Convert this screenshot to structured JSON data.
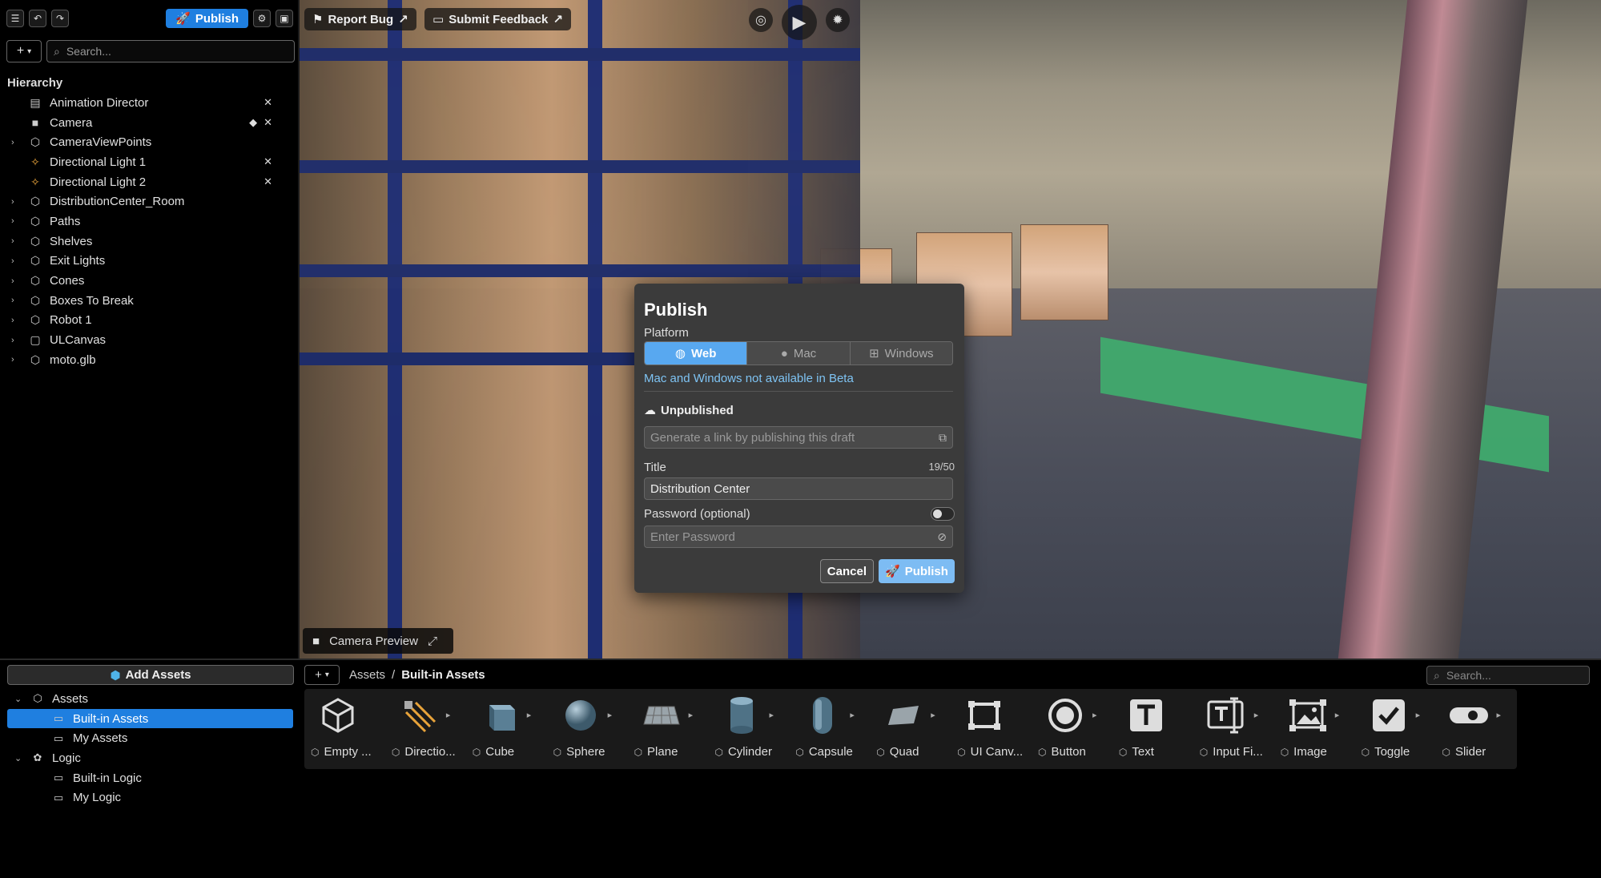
{
  "toolbar": {
    "publish_label": "Publish",
    "report_bug": "Report Bug",
    "submit_feedback": "Submit Feedback"
  },
  "hierarchy": {
    "search_placeholder": "Search...",
    "title": "Hierarchy",
    "items": [
      {
        "label": "Animation Director",
        "icon": "animation-icon",
        "expandable": false
      },
      {
        "label": "Camera",
        "icon": "camera-icon",
        "expandable": false
      },
      {
        "label": "CameraViewPoints",
        "icon": "cube-icon",
        "expandable": true
      },
      {
        "label": "Directional Light 1",
        "icon": "light-icon",
        "expandable": false
      },
      {
        "label": "Directional Light 2",
        "icon": "light-icon",
        "expandable": false
      },
      {
        "label": "DistributionCenter_Room",
        "icon": "cube-icon",
        "expandable": true
      },
      {
        "label": "Paths",
        "icon": "cube-icon",
        "expandable": true
      },
      {
        "label": "Shelves",
        "icon": "cube-icon",
        "expandable": true
      },
      {
        "label": "Exit Lights",
        "icon": "cube-icon",
        "expandable": true
      },
      {
        "label": "Cones",
        "icon": "cube-icon",
        "expandable": true
      },
      {
        "label": "Boxes To Break",
        "icon": "cube-icon",
        "expandable": true
      },
      {
        "label": "Robot 1",
        "icon": "cube-icon",
        "expandable": true
      },
      {
        "label": "ULCanvas",
        "icon": "canvas-icon",
        "expandable": true
      },
      {
        "label": "moto.glb",
        "icon": "cube-icon",
        "expandable": true
      }
    ]
  },
  "modal": {
    "title": "Publish",
    "platform_label": "Platform",
    "platforms": [
      "Web",
      "Mac",
      "Windows"
    ],
    "active_platform": "Web",
    "beta_note": "Mac and Windows not available in Beta",
    "status": "Unpublished",
    "link_placeholder": "Generate a link by publishing this draft",
    "title_label": "Title",
    "title_counter": "19/50",
    "title_value": "Distribution Center",
    "password_label": "Password (optional)",
    "password_placeholder": "Enter Password",
    "password_enabled": false,
    "cancel_label": "Cancel",
    "publish_label": "Publish"
  },
  "camera_preview": {
    "label": "Camera Preview"
  },
  "assets": {
    "add_label": "Add Assets",
    "tree": [
      {
        "label": "Assets",
        "level": 0,
        "expanded": true,
        "selected": false
      },
      {
        "label": "Built-in Assets",
        "level": 1,
        "expanded": false,
        "selected": true
      },
      {
        "label": "My Assets",
        "level": 1,
        "expanded": false,
        "selected": false
      },
      {
        "label": "Logic",
        "level": 0,
        "expanded": true,
        "selected": false
      },
      {
        "label": "Built-in Logic",
        "level": 1,
        "expanded": false,
        "selected": false
      },
      {
        "label": "My Logic",
        "level": 1,
        "expanded": false,
        "selected": false
      }
    ],
    "breadcrumb_root": "Assets",
    "breadcrumb_current": "Built-in Assets",
    "search_placeholder": "Search...",
    "items": [
      {
        "label": "Empty ...",
        "icon": "empty-cube-icon"
      },
      {
        "label": "Directio...",
        "icon": "directional-light-icon"
      },
      {
        "label": "Cube",
        "icon": "cube-icon"
      },
      {
        "label": "Sphere",
        "icon": "sphere-icon"
      },
      {
        "label": "Plane",
        "icon": "plane-icon"
      },
      {
        "label": "Cylinder",
        "icon": "cylinder-icon"
      },
      {
        "label": "Capsule",
        "icon": "capsule-icon"
      },
      {
        "label": "Quad",
        "icon": "quad-icon"
      },
      {
        "label": "UI Canv...",
        "icon": "ui-canvas-icon"
      },
      {
        "label": "Button",
        "icon": "button-icon"
      },
      {
        "label": "Text",
        "icon": "text-icon"
      },
      {
        "label": "Input Fi...",
        "icon": "input-field-icon"
      },
      {
        "label": "Image",
        "icon": "image-icon"
      },
      {
        "label": "Toggle",
        "icon": "toggle-icon"
      },
      {
        "label": "Slider",
        "icon": "slider-icon"
      }
    ]
  },
  "colors": {
    "accent": "#1f7fe0",
    "modal_bg": "#3b3b3b",
    "beta_note": "#7ec3f3"
  }
}
